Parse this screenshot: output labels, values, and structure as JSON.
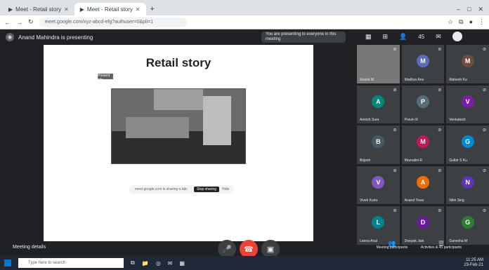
{
  "browser": {
    "tabs": [
      {
        "label": "Meet - Retail story",
        "active": false
      },
      {
        "label": "Meet - Retail story",
        "active": true
      }
    ],
    "new_tab": "+",
    "url": "meet.google.com/xyz-abcd-efg?authuser=0&pli=1",
    "window_controls": [
      "–",
      "□",
      "✕"
    ]
  },
  "meet": {
    "header_title": "Anand Mahindra is presenting",
    "presenting_notice": "You are presenting to everyone in this meeting",
    "participant_count": "45",
    "details_label": "Meeting details",
    "slide": {
      "title": "Retail story",
      "sticky_label": "Present tab"
    },
    "share_notice": {
      "text": "meet.google.com is sharing a tab.",
      "stop_label": "Stop sharing",
      "hide_label": "Hide"
    },
    "participants": [
      {
        "name": "Anand M",
        "initial": "",
        "color": "#8d6e63",
        "video": true
      },
      {
        "name": "Madhav Ans",
        "initial": "M",
        "color": "#5c6bc0",
        "video": false
      },
      {
        "name": "Mahesh Ku",
        "initial": "M",
        "color": "#6d4c41",
        "video": false
      },
      {
        "name": "Amrish Sure",
        "initial": "A",
        "color": "#00897b",
        "video": false
      },
      {
        "name": "Pravin R",
        "initial": "P",
        "color": "#546e7a",
        "video": false
      },
      {
        "name": "Venkatesh",
        "initial": "V",
        "color": "#7b1fa2",
        "video": false
      },
      {
        "name": "Brijesh",
        "initial": "B",
        "color": "#455a64",
        "video": false
      },
      {
        "name": "Mrunalini R",
        "initial": "M",
        "color": "#c2185b",
        "video": false
      },
      {
        "name": "Gulbir S Ku",
        "initial": "G",
        "color": "#0288d1",
        "video": false
      },
      {
        "name": "Vivek Kurla",
        "initial": "V",
        "color": "#7e57c2",
        "video": false
      },
      {
        "name": "Anand Tiwar",
        "initial": "A",
        "color": "#ef6c00",
        "video": false
      },
      {
        "name": "Nitin Sing",
        "initial": "N",
        "color": "#5e35b1",
        "video": false
      },
      {
        "name": "Leena Anal",
        "initial": "L",
        "color": "#00838f",
        "video": false
      },
      {
        "name": "Deepak Jain",
        "initial": "D",
        "color": "#6a1b9a",
        "video": false
      },
      {
        "name": "Ganesha M",
        "initial": "G",
        "color": "#2e7d32",
        "video": false
      }
    ],
    "right_tools": [
      {
        "label": "Meeting participants",
        "icon": "👥"
      },
      {
        "label": "Activities & 45 participants",
        "icon": "☰"
      }
    ]
  },
  "taskbar": {
    "search_placeholder": "Type here to search",
    "tray_time": "11:25 AM",
    "tray_date": "23-Feb-21"
  },
  "colors": {
    "accent": "#1a73e8",
    "end_call": "#ea4335",
    "bg": "#202124"
  }
}
